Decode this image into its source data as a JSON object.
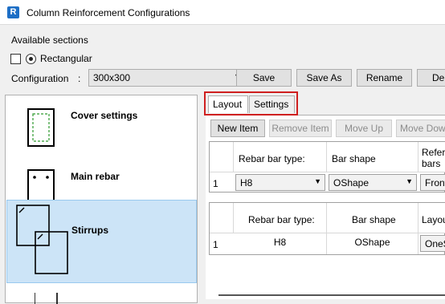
{
  "window": {
    "title": "Column Reinforcement Configurations",
    "app_icon": "R"
  },
  "available_sections": {
    "label": "Available sections",
    "option_label": "Rectangular"
  },
  "configuration": {
    "label": "Configuration",
    "colon": ":",
    "value": "300x300",
    "save": "Save",
    "save_as": "Save As",
    "rename": "Rename",
    "delete": "Del"
  },
  "sections": [
    {
      "label": "Cover settings"
    },
    {
      "label": "Main rebar"
    },
    {
      "label": "Stirrups"
    }
  ],
  "tabs": {
    "layout": "Layout",
    "settings": "Settings"
  },
  "toolbar": {
    "new_item": "New Item",
    "remove_item": "Remove Item",
    "move_up": "Move Up",
    "move_down": "Move Dow"
  },
  "grid1": {
    "headers": [
      "Rebar bar type:",
      "Bar shape",
      "Refer",
      "bars"
    ],
    "row": {
      "num": "1",
      "bar_type": "H8",
      "bar_shape": "OShape",
      "ref": "Front"
    }
  },
  "grid2": {
    "headers": [
      "Rebar bar type:",
      "Bar shape",
      "Layou"
    ],
    "row": {
      "num": "1",
      "bar_type": "H8",
      "bar_shape": "OShape",
      "layout": "OneS"
    }
  },
  "colors": {
    "accent_highlight": "#cf1f1f",
    "selected_bg": "#cce4f7"
  }
}
